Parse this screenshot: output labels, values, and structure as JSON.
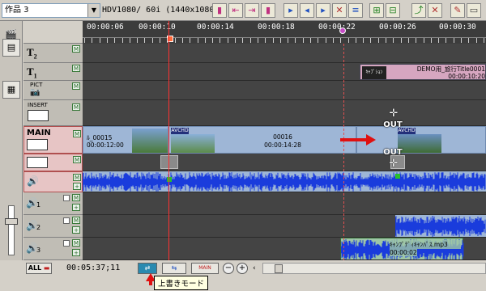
{
  "toolbar": {
    "project_select": "作品 3",
    "format_label": "HDV1080/ 60i (1440x1080)"
  },
  "ruler": {
    "timecodes": [
      "00:00:06",
      "00:00:10",
      "00:00:14",
      "00:00:18",
      "00:00:22",
      "00:00:26",
      "00:00:30"
    ]
  },
  "tracks": {
    "t2": {
      "label": "T",
      "sub": "2"
    },
    "t1": {
      "label": "T",
      "sub": "1"
    },
    "pict": {
      "label": "PICT"
    },
    "insert": {
      "label": "INSERT"
    },
    "main": {
      "label": "MAIN"
    },
    "a1": {
      "sub": "1"
    },
    "a2": {
      "sub": "2"
    },
    "a3": {
      "sub": "3"
    }
  },
  "clips": {
    "t1_title": {
      "name": "DEMO用_旅行Title0001",
      "tc": "00:00:10:20",
      "thumb_text": "ｷｬﾌﾟｼｮﾝ"
    },
    "main_clip1": {
      "name": "ﾙ_00015",
      "tc": "00:00:12:00"
    },
    "main_clip2": {
      "name": "00016",
      "tc": "00:00:14:28"
    },
    "avchd_badge": "AVCHD",
    "a3_clip": {
      "name": "ｷｬﾝﾌﾟﾃﾞｨｷｬﾝﾊﾟｽ.mp3",
      "tc": "00:00:02"
    }
  },
  "cursor": {
    "out_top": "OUT",
    "out_bottom": "OUT"
  },
  "bottom": {
    "all_label": "ALL",
    "timecode": "00:05:37;11",
    "tooltip": "上書きモード"
  },
  "colors": {
    "main_video_track": "#9eb6d6",
    "audio_wave": "#1a3cdc",
    "playhead": "#ff3030",
    "in_point": "#e05050",
    "marker": "#c64cc6"
  }
}
